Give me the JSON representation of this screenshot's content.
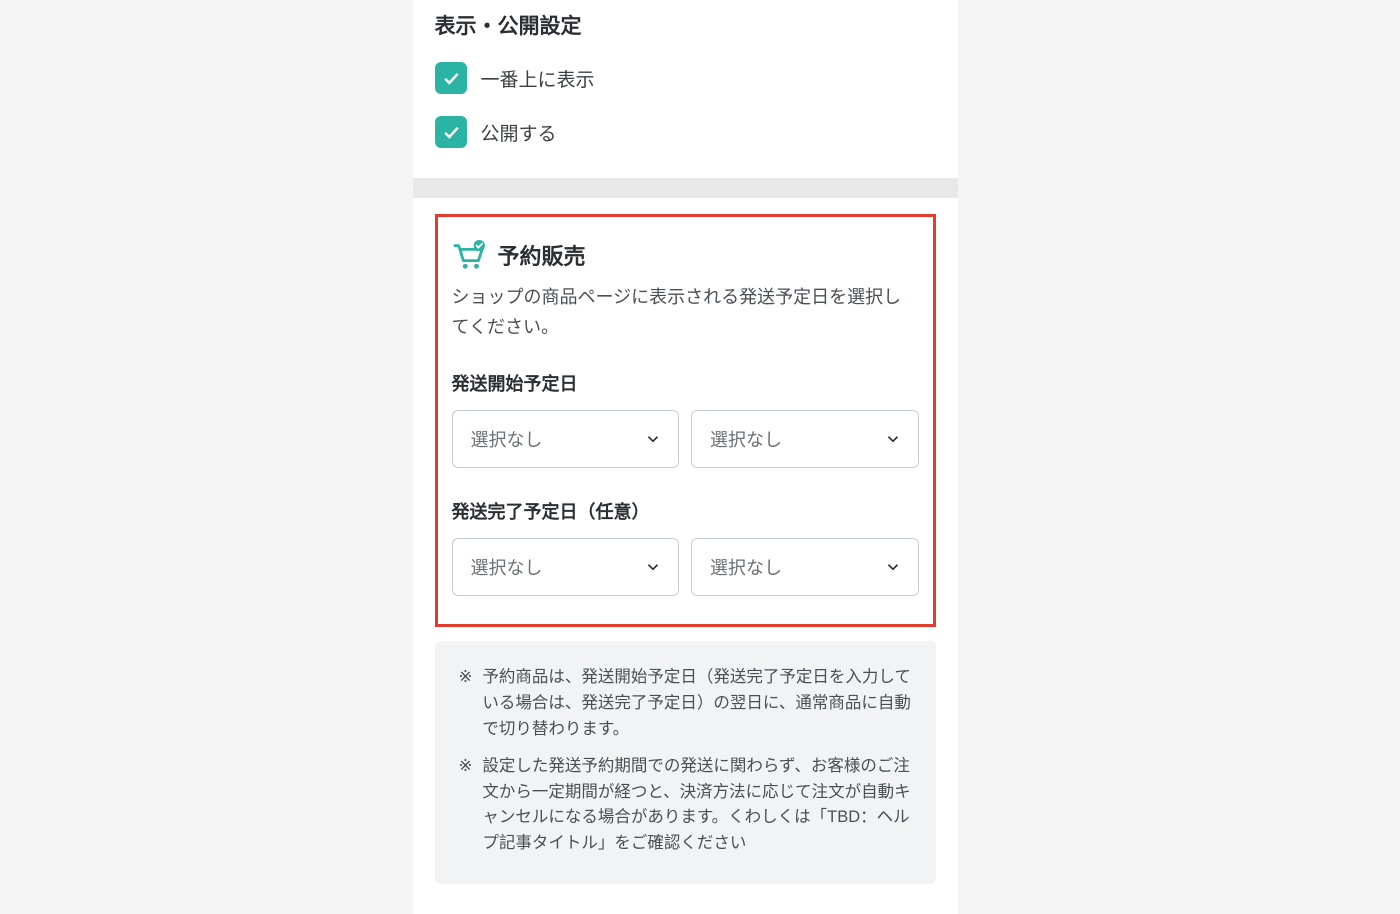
{
  "display_settings": {
    "title": "表示・公開設定",
    "checkbox_top_label": "一番上に表示",
    "checkbox_publish_label": "公開する"
  },
  "preorder": {
    "title": "予約販売",
    "description": "ショップの商品ページに表示される発送予定日を選択してください。",
    "start_date_label": "発送開始予定日",
    "end_date_label": "発送完了予定日（任意）",
    "select_placeholder": "選択なし"
  },
  "notes": {
    "marker": "※",
    "note1": "予約商品は、発送開始予定日（発送完了予定日を入力している場合は、発送完了予定日）の翌日に、通常商品に自動で切り替わります。",
    "note2": "設定した発送予約期間での発送に関わらず、お客様のご注文から一定期間が経つと、決済方法に応じて注文が自動キャンセルになる場合があります。くわしくは「TBD：ヘルプ記事タイトル」をご確認ください"
  },
  "colors": {
    "accent": "#2bb3a3",
    "highlight_border": "#e33b2e"
  }
}
